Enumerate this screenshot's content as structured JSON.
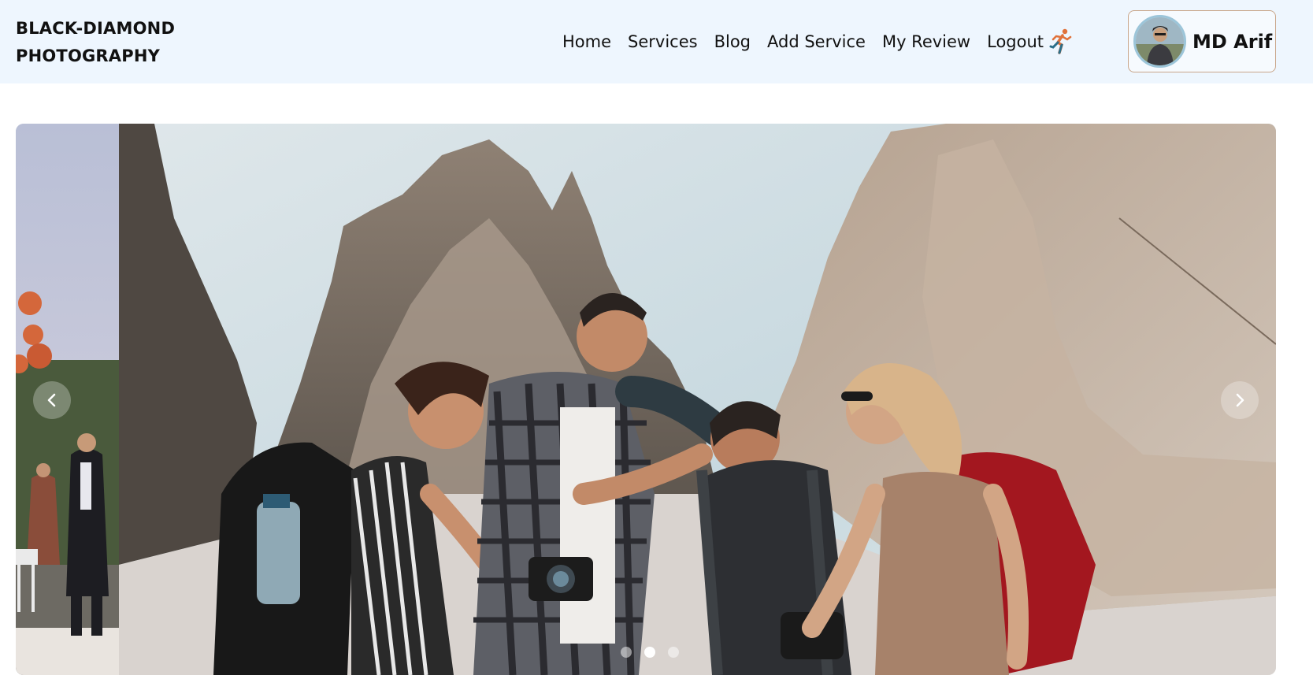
{
  "brand": {
    "line1": "BLACK-DIAMOND",
    "line2": "PHOTOGRAPHY"
  },
  "nav": {
    "items": [
      {
        "label": "Home"
      },
      {
        "label": "Services"
      },
      {
        "label": "Blog"
      },
      {
        "label": "Add Service"
      },
      {
        "label": "My Review"
      }
    ],
    "logout_label": "Logout",
    "logout_icon": "running-man-icon"
  },
  "user": {
    "name": "MD Arif",
    "avatar_icon": "user-avatar"
  },
  "carousel": {
    "active_index": 1,
    "slide_count": 3,
    "prev_icon": "chevron-left-icon",
    "next_icon": "chevron-right-icon"
  },
  "colors": {
    "nav_bg": "#eef6fe",
    "accent_runner": "#e0713a",
    "profile_border": "#c9a68a"
  }
}
